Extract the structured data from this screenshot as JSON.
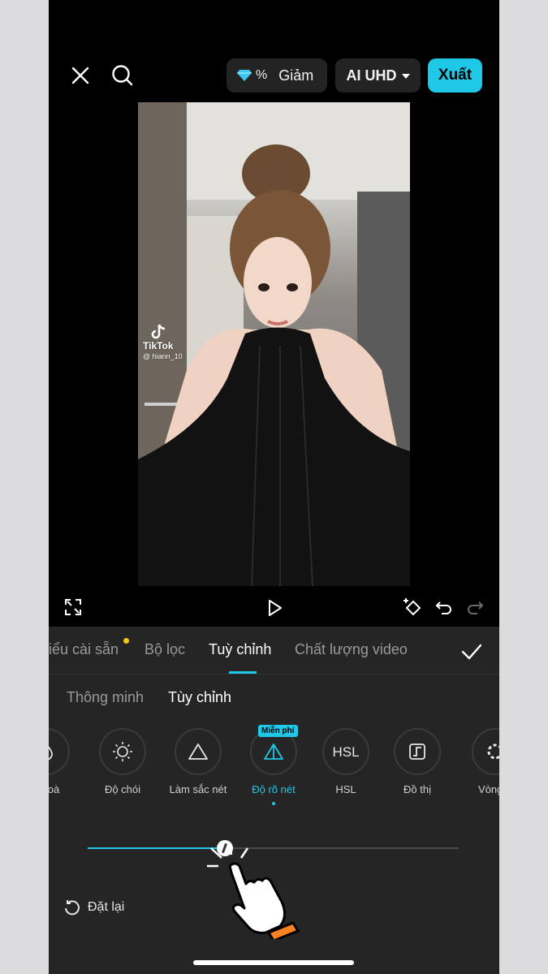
{
  "topbar": {
    "promo_percent": "%",
    "promo_label": "Giảm",
    "quality_label": "AI UHD",
    "export_label": "Xuất"
  },
  "preview": {
    "watermark_brand": "TikTok",
    "watermark_handle": "@ hiann_10"
  },
  "tabs": [
    {
      "label": "iểu cài sẵn"
    },
    {
      "label": "Bộ lọc"
    },
    {
      "label": "Tuỳ chỉnh"
    },
    {
      "label": "Chất lượng video"
    }
  ],
  "subtabs": [
    {
      "label": "Thông minh"
    },
    {
      "label": "Tùy chỉnh"
    }
  ],
  "tools": [
    {
      "label": "o hoà",
      "icon": "drop-icon"
    },
    {
      "label": "Độ chói",
      "icon": "sun-icon"
    },
    {
      "label": "Làm sắc nét",
      "icon": "triangle-icon"
    },
    {
      "label": "Độ rõ nét",
      "icon": "clarity-icon",
      "badge": "Miễn phí"
    },
    {
      "label": "HSL",
      "icon": "hsl-icon"
    },
    {
      "label": "Đồ thị",
      "icon": "curve-icon"
    },
    {
      "label": "Vòng tr",
      "icon": "wheel-icon"
    }
  ],
  "slider": {
    "value_fraction": 0.37
  },
  "reset_label": "Đặt lại",
  "colors": {
    "accent": "#1ec8e6",
    "panel": "#252525",
    "badge_dot": "#f5c518"
  }
}
